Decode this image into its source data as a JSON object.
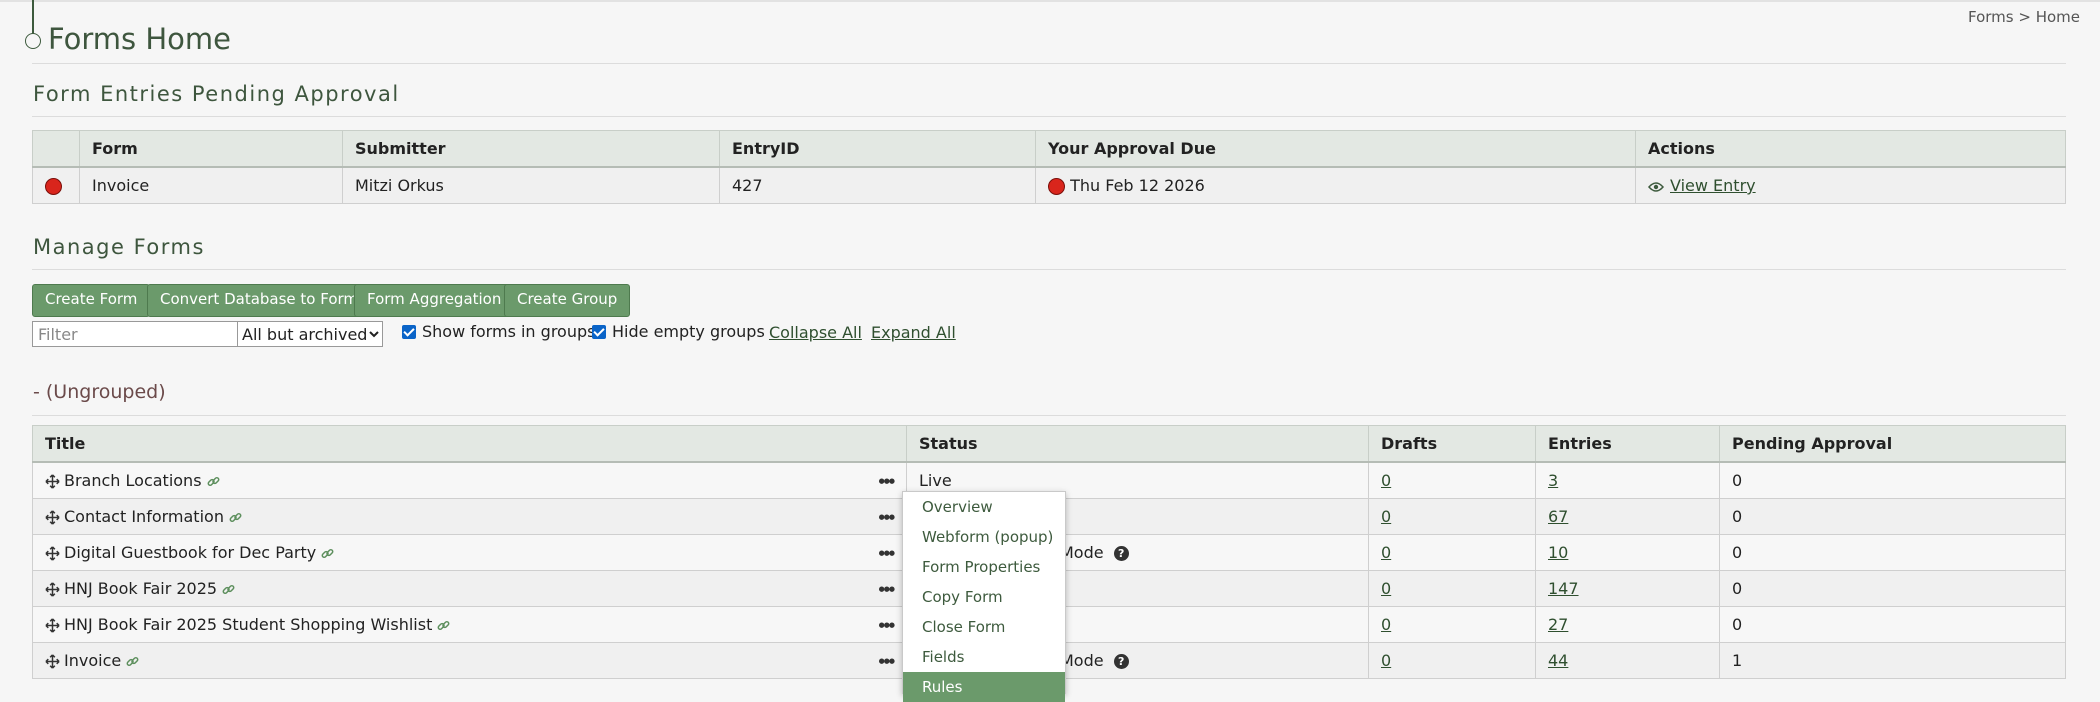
{
  "breadcrumb": "Forms > Home",
  "page_title": "Forms Home",
  "pending": {
    "title": "Form Entries Pending Approval",
    "columns": [
      "",
      "Form",
      "Submitter",
      "EntryID",
      "Your Approval Due",
      "Actions"
    ],
    "rows": [
      {
        "form": "Invoice",
        "submitter": "Mitzi Orkus",
        "entry_id": "427",
        "due": "Thu Feb 12 2026",
        "action": "View Entry"
      }
    ]
  },
  "manage": {
    "title": "Manage Forms",
    "buttons": [
      "Create Form",
      "Convert Database to Form",
      "Form Aggregation",
      "Create Group"
    ],
    "filter_placeholder": "Filter",
    "select_value": "All but archived",
    "show_forms_in_groups": "Show forms in groups",
    "hide_empty_groups": "Hide empty groups",
    "collapse_all": "Collapse All",
    "expand_all": "Expand All"
  },
  "group": {
    "title": "-   (Ungrouped)",
    "columns": [
      "Title",
      "Status",
      "Drafts",
      "Entries",
      "Pending Approval"
    ],
    "rows": [
      {
        "title": "Branch Locations",
        "status": "Live",
        "drafts": "0",
        "entries": "3",
        "pending": "0"
      },
      {
        "title": "Contact Information",
        "status": "",
        "drafts": "0",
        "entries": "67",
        "pending": "0"
      },
      {
        "title": "Digital Guestbook for Dec Party",
        "status": "Mode",
        "drafts": "0",
        "entries": "10",
        "pending": "0"
      },
      {
        "title": "HNJ Book Fair 2025",
        "status": "",
        "drafts": "0",
        "entries": "147",
        "pending": "0"
      },
      {
        "title": "HNJ Book Fair 2025 Student Shopping Wishlist",
        "status": "",
        "drafts": "0",
        "entries": "27",
        "pending": "0"
      },
      {
        "title": "Invoice",
        "status": "Mode",
        "drafts": "0",
        "entries": "44",
        "pending": "1"
      }
    ]
  },
  "context_menu": [
    "Overview",
    "Webform (popup)",
    "Form Properties",
    "Copy Form",
    "Close Form",
    "Fields",
    "Rules"
  ],
  "colors": {
    "accent": "#6b9a6b",
    "header_bg": "#e3e8e3",
    "title": "#3e563e",
    "alert_red": "#d9251c"
  }
}
